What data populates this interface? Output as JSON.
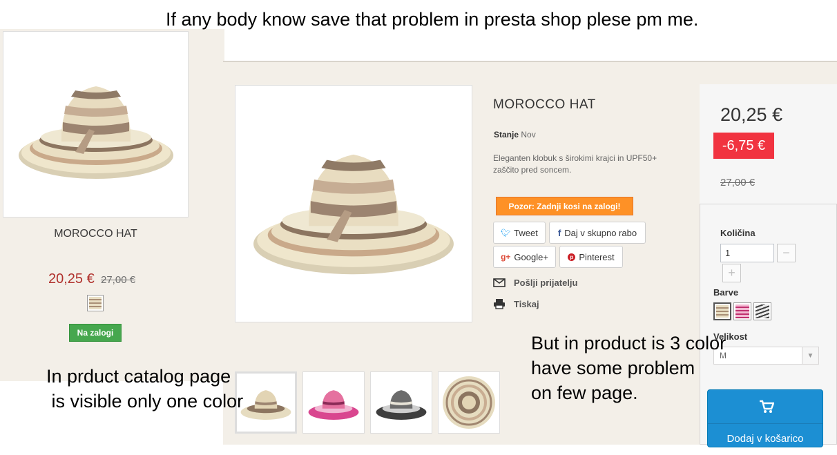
{
  "annotations": {
    "top": "If any body know save that problem in presta shop plese pm me.",
    "left": "In prduct catalog page\n is visible only one color",
    "right": "But in product is 3 color\nhave some problem\non few page."
  },
  "catalog": {
    "product_name": "MOROCCO HAT",
    "price": "20,25 €",
    "old_price": "27,00 €",
    "stock_badge": "Na zalogi"
  },
  "product": {
    "title": "MOROCCO HAT",
    "condition_label": "Stanje",
    "condition_value": "Nov",
    "description": "Eleganten klobuk s širokimi krajci in UPF50+\nzaščito pred soncem.",
    "warning": "Pozor: Zadnji kosi na zalogi!",
    "social": {
      "tweet": "Tweet",
      "share": "Daj v skupno rabo",
      "google": "Google+",
      "pinterest": "Pinterest"
    },
    "send_friend": "Pošlji prijatelju",
    "print": "Tiskaj"
  },
  "buy_box": {
    "price": "20,25 €",
    "discount": "-6,75 €",
    "old_price": "27,00 €",
    "quantity_label": "Količina",
    "quantity_value": "1",
    "color_label": "Barve",
    "size_label": "Velikost",
    "size_value": "M",
    "add_to_cart": "Dodaj v košarico"
  },
  "colors": {
    "accent_red": "#b0302c",
    "badge_green": "#46a74e",
    "warning_orange": "#fe9126",
    "discount_red": "#f13340",
    "cart_blue": "#1c8fd3"
  }
}
